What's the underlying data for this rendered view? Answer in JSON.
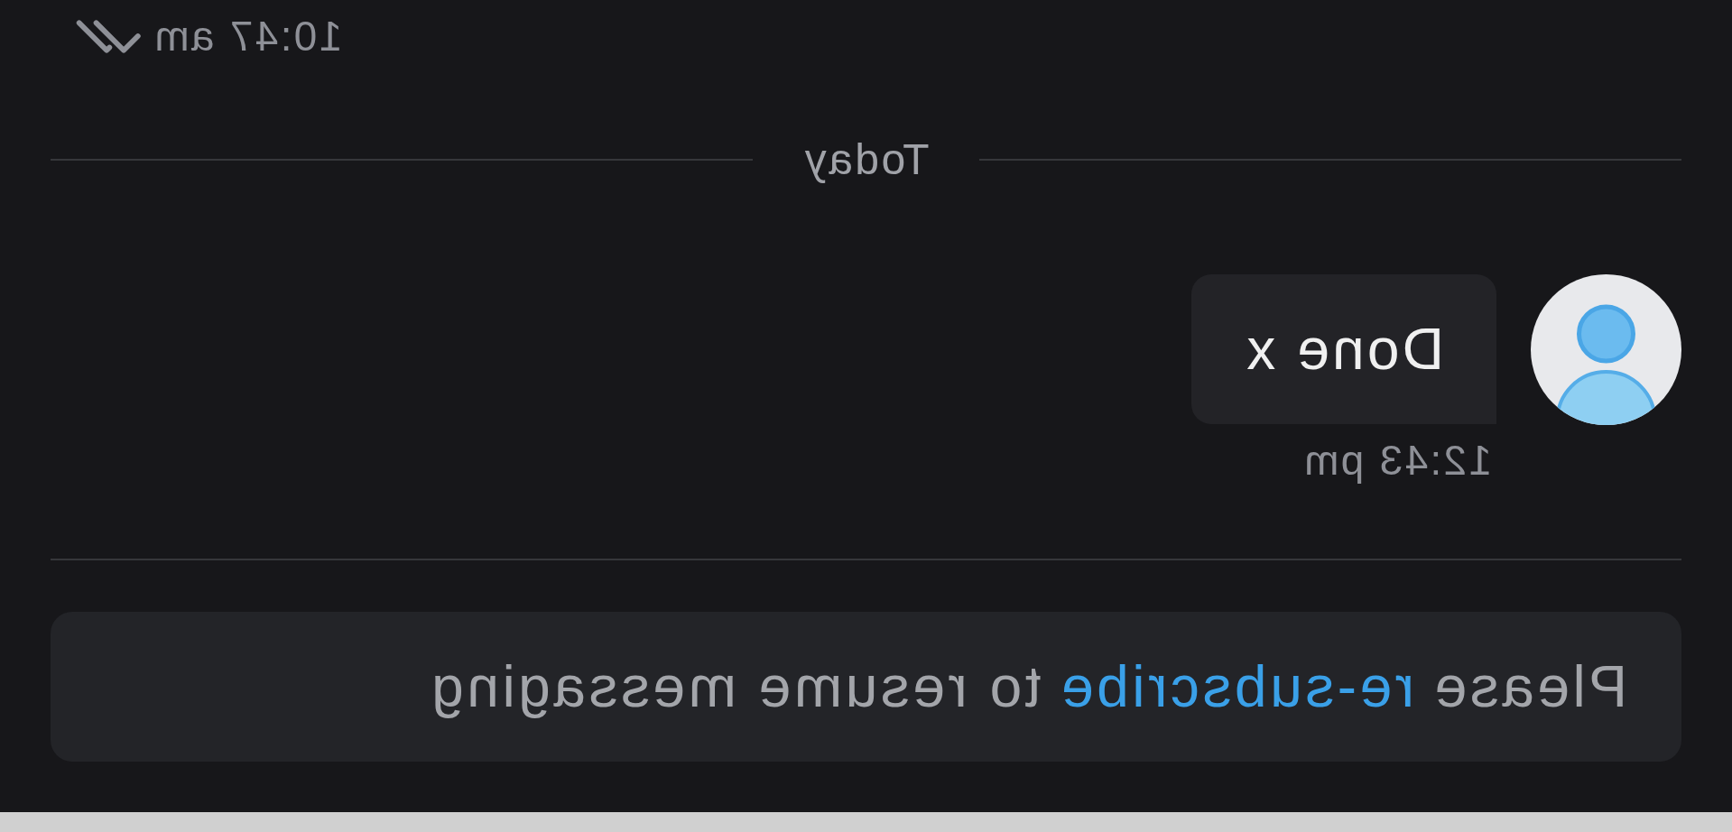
{
  "previous_message": {
    "time": "10:47 am",
    "read": true
  },
  "day_divider": {
    "label": "Today"
  },
  "messages": [
    {
      "text": "Done x",
      "time": "12:43 pm"
    }
  ],
  "notice": {
    "before": "Please",
    "link": "re-subscribe",
    "after": "to resume messaging"
  }
}
